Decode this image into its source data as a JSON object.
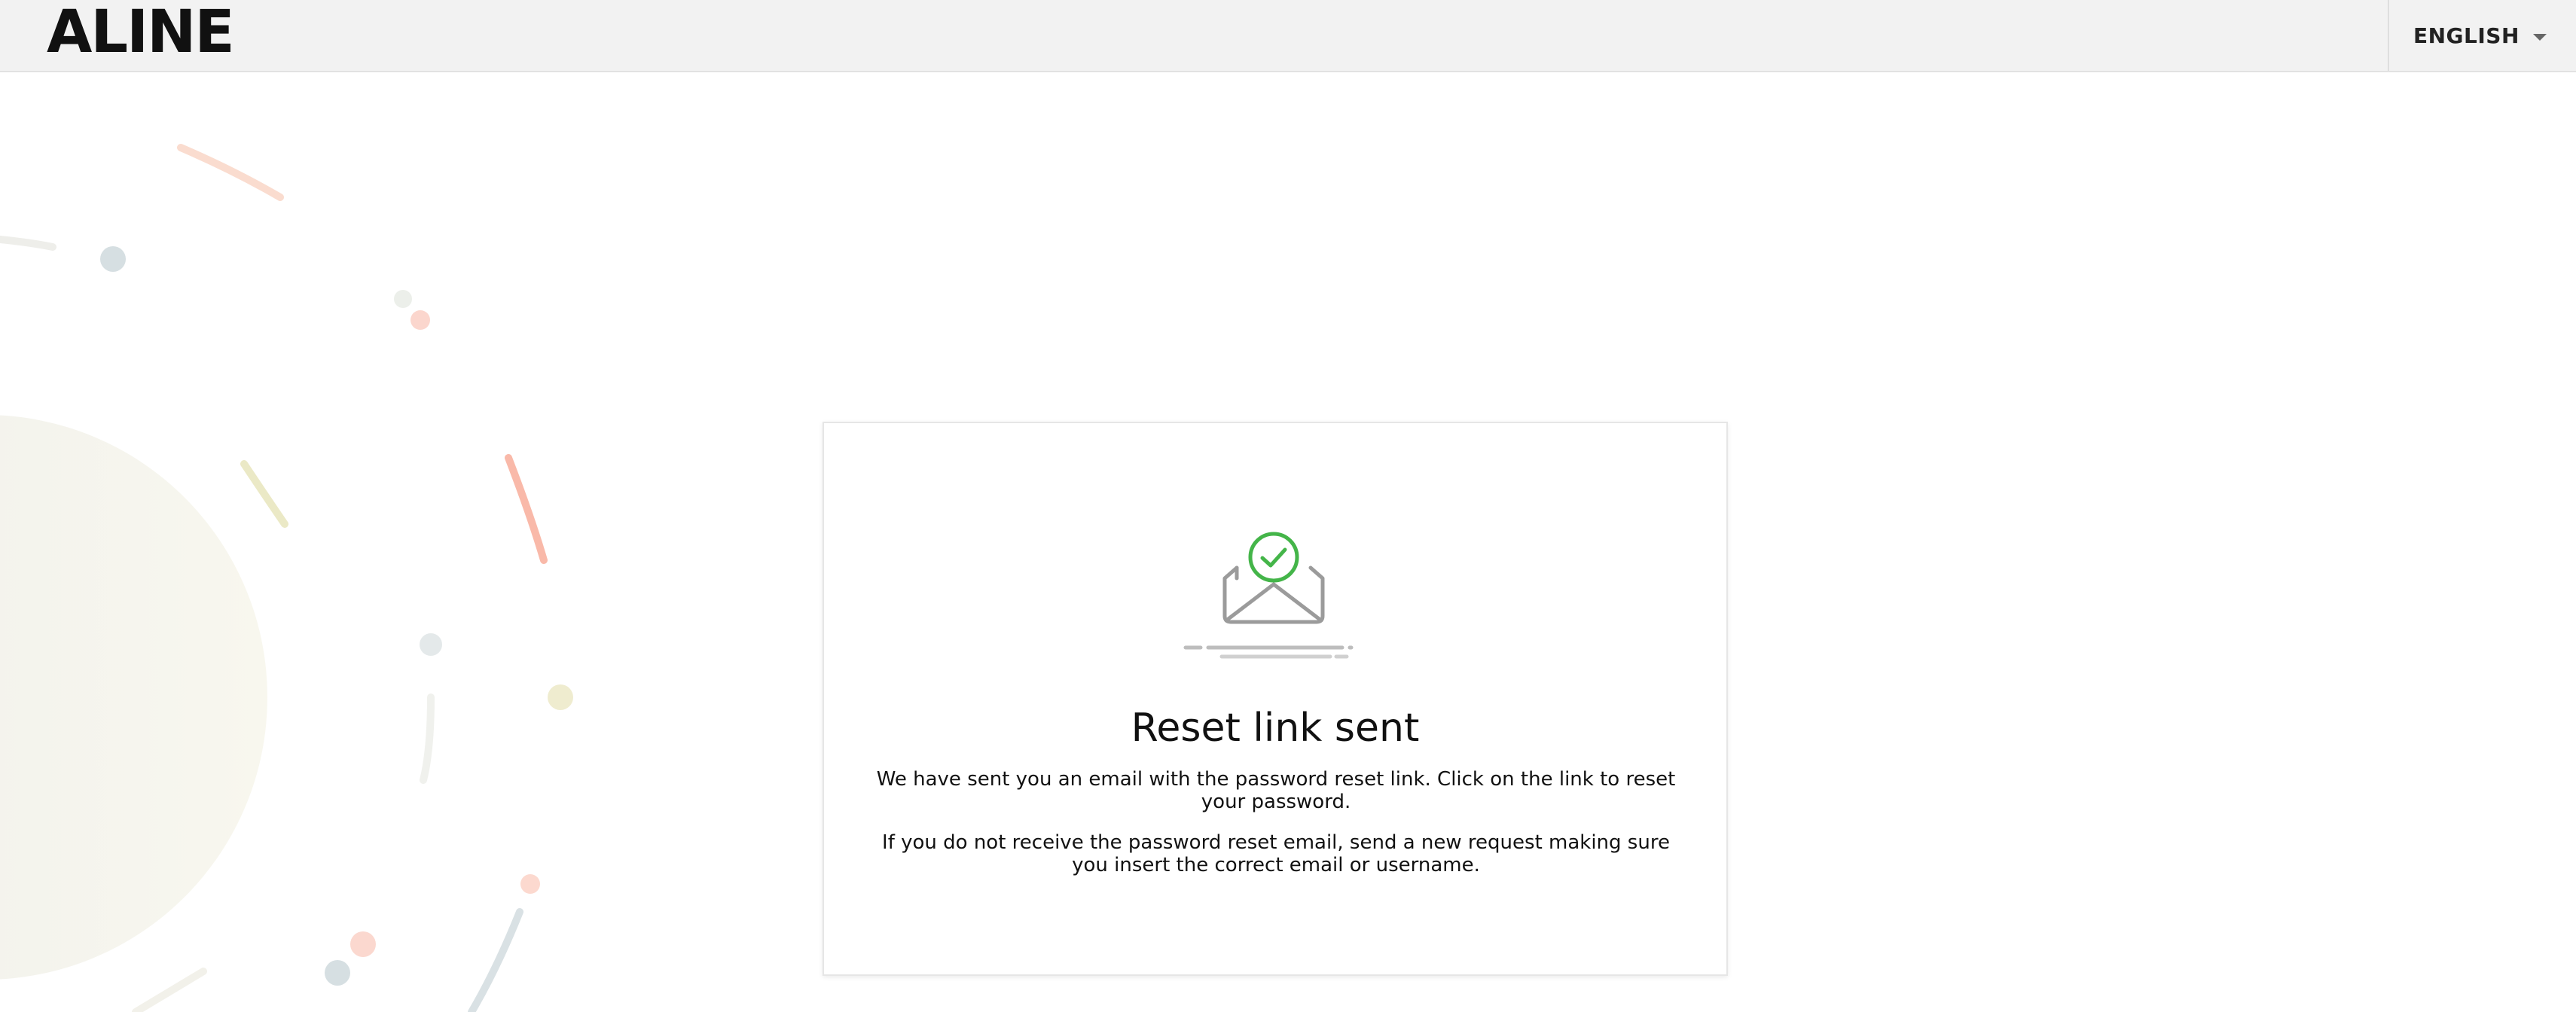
{
  "header": {
    "logo_text": "ALINE",
    "language_label": "ENGLISH"
  },
  "card": {
    "title": "Reset link sent",
    "message_1": "We have sent you an email with the password reset link. Click on the link to reset your password.",
    "message_2": "If you do not receive the password reset email, send a new request making sure you insert the correct email or username."
  },
  "colors": {
    "success": "#44b549",
    "envelope": "#9b9b9b"
  },
  "icons": {
    "card_icon": "envelope-check-icon",
    "language_caret": "chevron-down-icon"
  }
}
